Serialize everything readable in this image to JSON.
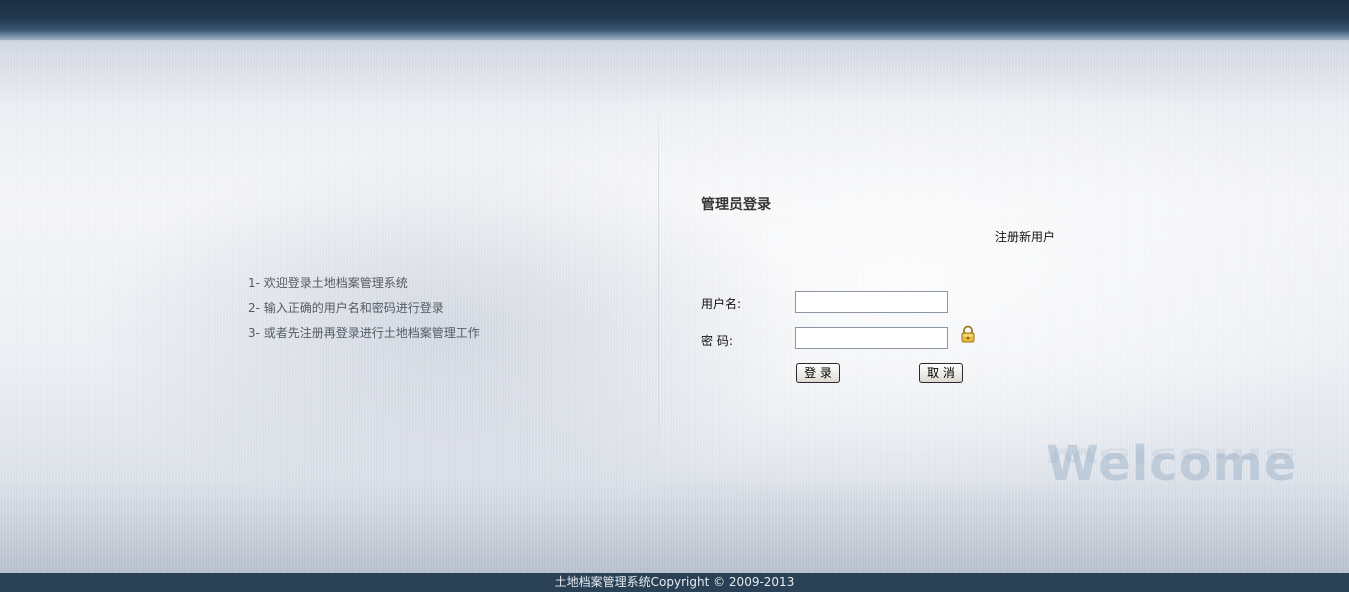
{
  "instructions": {
    "items": [
      "1- 欢迎登录土地档案管理系统",
      "2- 输入正确的用户名和密码进行登录",
      "3- 或者先注册再登录进行土地档案管理工作"
    ]
  },
  "login": {
    "title": "管理员登录",
    "register_link": "注册新用户",
    "username_label": "用户名:",
    "password_label": "密 码:",
    "username_value": "",
    "password_value": "",
    "login_button": "登 录",
    "cancel_button": "取 消",
    "lock_icon": "lock-icon"
  },
  "watermark": {
    "text": "Welcome"
  },
  "footer": {
    "copyright": "土地档案管理系统Copyright © 2009-2013"
  },
  "colors": {
    "top_bar": "#1c2f44",
    "footer_bar": "#2a4155",
    "background": "#eef1f6"
  }
}
